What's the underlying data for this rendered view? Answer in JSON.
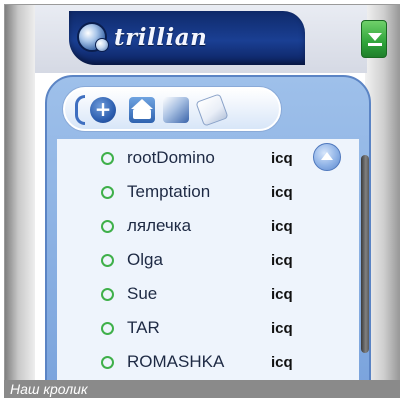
{
  "header": {
    "app_name": "trillian",
    "logo_icon": "trillian-orb-logo",
    "menu_icon": "chevron-down-menu"
  },
  "toolbar": {
    "icons": [
      "plus-circle-icon",
      "home-icon",
      "cube-icon",
      "note-icon"
    ]
  },
  "contacts": [
    {
      "name": "rootDomino",
      "protocol": "icq",
      "status": "online"
    },
    {
      "name": "Temptation",
      "protocol": "icq",
      "status": "online"
    },
    {
      "name": "лялечка",
      "protocol": "icq",
      "status": "online"
    },
    {
      "name": "Olga",
      "protocol": "icq",
      "status": "online"
    },
    {
      "name": "Sue",
      "protocol": "icq",
      "status": "online"
    },
    {
      "name": "TAR",
      "protocol": "icq",
      "status": "online"
    },
    {
      "name": "ROMASHKA",
      "protocol": "icq",
      "status": "online"
    }
  ],
  "caption": "Наш кролик",
  "colors": {
    "status_online": "#3fb04a",
    "brand_blue": "#1a3f93",
    "menu_green": "#2fa43a"
  }
}
